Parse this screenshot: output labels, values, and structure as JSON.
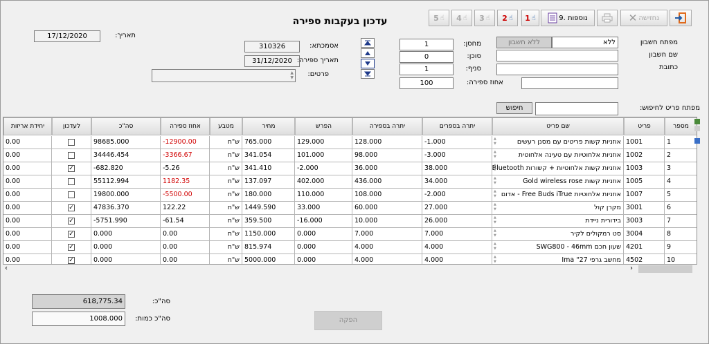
{
  "window": {
    "title": "עדכון בעקבות ספירה"
  },
  "toolbar": {
    "exit_label": "",
    "cancel_label": "נחזישה",
    "print_label": "",
    "extras_label": "9. נוספות",
    "step1": "1",
    "step2": "2",
    "step3": "3",
    "step4": "4",
    "step5": "5"
  },
  "header": {
    "date_label": "תאריך:",
    "date_value": "17/12/2020",
    "account_key_label": "מפתח חשבון",
    "account_key_value": "ללא",
    "no_account_label": "ללא חשבון",
    "account_name_label": "שם חשבון",
    "address_label": "כתובת",
    "warehouse_label": "מחסן:",
    "warehouse_value": "1",
    "agent_label": "סוכן:",
    "agent_value": "0",
    "branch_label": "סניף:",
    "branch_value": "1",
    "percent_label": "אחוז ספירה:",
    "percent_value": "100",
    "reference_label": "אסמכתא:",
    "reference_value": "310326",
    "count_date_label": "תאריך ספירה:",
    "count_date_value": "31/12/2020",
    "details_label": "פרטים:"
  },
  "search": {
    "label": "מפתח פריט לחיפוש:",
    "button": "חיפוש",
    "value": ""
  },
  "table": {
    "columns": {
      "num": "מספר",
      "code": "פריט",
      "name": "שם פריט",
      "qty_books": "יתרה בספרים",
      "qty_count": "יתרה בספירה",
      "diff": "הפרש",
      "price": "מחיר",
      "currency": "מטבע",
      "pct": "אחוז ספירה",
      "total": "סה\"כ",
      "update": "לעדכון",
      "pack": "יחידת אריזות"
    },
    "rows": [
      {
        "num": "1",
        "code": "1001",
        "name": "אוזניות קשות פריטים עם מסנן רעשים",
        "books": "-1.000",
        "count": "128.000",
        "diff": "129.000",
        "price": "765.000",
        "cur": "ש\"ח",
        "pct": "-12900.00",
        "pct_red": true,
        "total": "98685.000",
        "checked": false,
        "pack": "0.00"
      },
      {
        "num": "2",
        "code": "1002",
        "name": "אוזניות אלחוטיות עם טעינה אלחוטית",
        "books": "-3.000",
        "count": "98.000",
        "diff": "101.000",
        "price": "341.054",
        "cur": "ש\"ח",
        "pct": "-3366.67",
        "pct_red": true,
        "total": "34446.454",
        "checked": false,
        "pack": "0.00"
      },
      {
        "num": "3",
        "code": "1003",
        "name": "אוזניות קשות אלחוטיות + קשורות Bluetooth",
        "books": "38.000",
        "count": "36.000",
        "diff": "-2.000",
        "price": "341.410",
        "cur": "ש\"ח",
        "pct": "-5.26",
        "pct_red": false,
        "total": "-682.820",
        "checked": true,
        "pack": "0.00"
      },
      {
        "num": "4",
        "code": "1005",
        "name": "אוזניות קשות Gold wireless rose",
        "books": "34.000",
        "count": "436.000",
        "diff": "402.000",
        "price": "137.097",
        "cur": "ש\"ח",
        "pct": "1182.35",
        "pct_red": true,
        "total": "55112.994",
        "checked": false,
        "pack": "0.00"
      },
      {
        "num": "5",
        "code": "1007",
        "name": "אוזניות אלחוטיות Free Buds iTrue - אדום",
        "books": "-2.000",
        "count": "108.000",
        "diff": "110.000",
        "price": "180.000",
        "cur": "ש\"ח",
        "pct": "-5500.00",
        "pct_red": true,
        "total": "19800.000",
        "checked": false,
        "pack": "0.00"
      },
      {
        "num": "6",
        "code": "3001",
        "name": "מקרן קול",
        "books": "27.000",
        "count": "60.000",
        "diff": "33.000",
        "price": "1449.590",
        "cur": "ש\"ח",
        "pct": "122.22",
        "pct_red": false,
        "total": "47836.370",
        "checked": true,
        "pack": "0.00"
      },
      {
        "num": "7",
        "code": "3003",
        "name": "בידורית ניידת",
        "books": "26.000",
        "count": "10.000",
        "diff": "-16.000",
        "price": "359.500",
        "cur": "ש\"ח",
        "pct": "-61.54",
        "pct_red": false,
        "total": "-5751.990",
        "checked": true,
        "pack": "0.00"
      },
      {
        "num": "8",
        "code": "3004",
        "name": "סט רמקולים לקיר",
        "books": "7.000",
        "count": "7.000",
        "diff": "0.000",
        "price": "1150.000",
        "cur": "ש\"ח",
        "pct": "0.00",
        "pct_red": false,
        "total": "0.000",
        "checked": true,
        "pack": "0.00"
      },
      {
        "num": "9",
        "code": "4201",
        "name": "שעון חכם SWG800 - 46mm",
        "books": "4.000",
        "count": "4.000",
        "diff": "0.000",
        "price": "815.974",
        "cur": "ש\"ח",
        "pct": "0.00",
        "pct_red": false,
        "total": "0.000",
        "checked": true,
        "pack": "0.00"
      },
      {
        "num": "10",
        "code": "4502",
        "name": "מחשב גרפי 27\" Ima",
        "books": "4.000",
        "count": "4.000",
        "diff": "0.000",
        "price": "5000.000",
        "cur": "ש\"ח",
        "pct": "0.00",
        "pct_red": false,
        "total": "0.000",
        "checked": true,
        "pack": "0.00"
      }
    ]
  },
  "footer": {
    "total_label": "סה\"כ:",
    "total_value": "618,775.34",
    "qty_label": "סה\"כ כמות:",
    "qty_value": "1008.000",
    "produce_button": "הפקה"
  },
  "colors": {
    "negative": "#d10000",
    "accent": "#e06a1b"
  }
}
